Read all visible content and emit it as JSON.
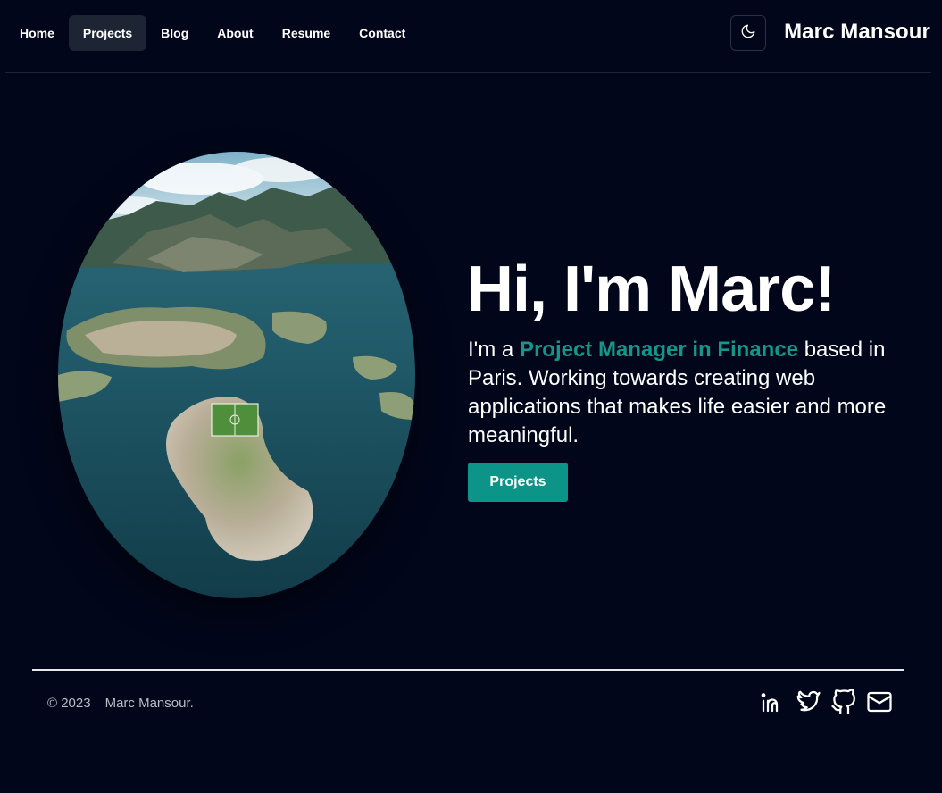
{
  "nav": {
    "items": [
      {
        "label": "Home",
        "active": false
      },
      {
        "label": "Projects",
        "active": true
      },
      {
        "label": "Blog",
        "active": false
      },
      {
        "label": "About",
        "active": false
      },
      {
        "label": "Resume",
        "active": false
      },
      {
        "label": "Contact",
        "active": false
      }
    ],
    "theme_icon": "moon-icon",
    "brand": "Marc Mansour"
  },
  "hero": {
    "title": "Hi, I'm Marc!",
    "intro_prefix": "I'm a ",
    "highlight": "Project Manager in Finance",
    "intro_suffix": " based in Paris. Working towards creating web applications that makes life easier and more meaningful.",
    "cta_label": "Projects",
    "image_icon": "island-landscape-photo"
  },
  "footer": {
    "year": "© 2023",
    "name": "Marc Mansour.",
    "socials": [
      "linkedin-icon",
      "twitter-icon",
      "github-icon",
      "mail-icon"
    ]
  },
  "colors": {
    "background": "#02061a",
    "accent": "#0d9488",
    "highlight_text": "#14978a",
    "active_nav_bg": "#1d2433"
  }
}
